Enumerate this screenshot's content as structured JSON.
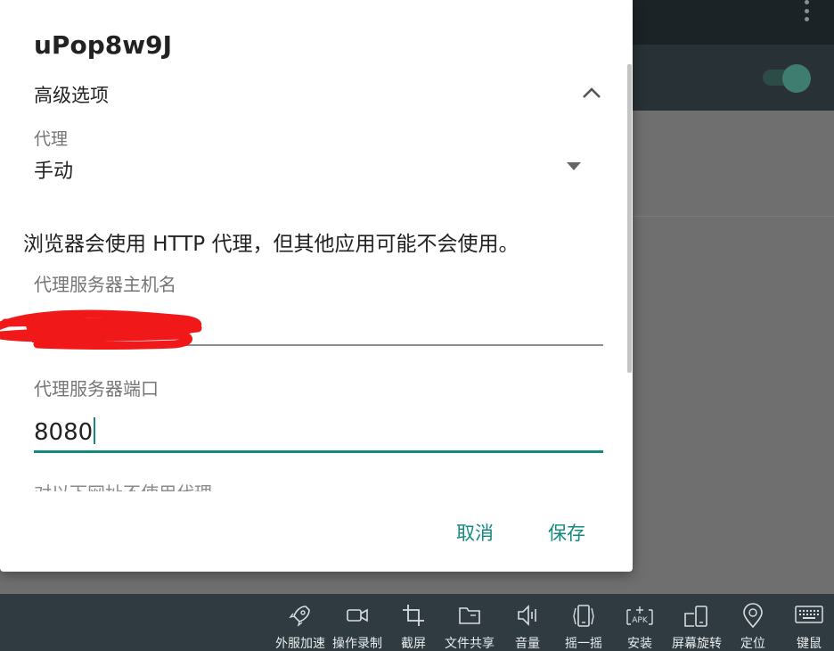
{
  "dialog": {
    "title": "uPop8w9J",
    "advanced_label": "高级选项",
    "proxy": {
      "label": "代理",
      "value": "手动"
    },
    "warning": "浏览器会使用 HTTP 代理，但其他应用可能不会使用。",
    "hostname": {
      "label": "代理服务器主机名",
      "value": ""
    },
    "port": {
      "label": "代理服务器端口",
      "value": "8080"
    },
    "bypass_label": "对以下网址不使用代理",
    "cancel_label": "取消",
    "save_label": "保存",
    "accent_color": "#138a7d"
  },
  "toolbar": {
    "items": [
      {
        "label": "外服加速",
        "icon": "rocket-icon"
      },
      {
        "label": "操作录制",
        "icon": "video-camera-icon"
      },
      {
        "label": "截屏",
        "icon": "crop-icon"
      },
      {
        "label": "文件共享",
        "icon": "folder-icon"
      },
      {
        "label": "音量",
        "icon": "speaker-icon"
      },
      {
        "label": "摇一摇",
        "icon": "shake-phone-icon"
      },
      {
        "label": "安装",
        "icon": "apk-install-icon"
      },
      {
        "label": "屏幕旋转",
        "icon": "screen-rotate-icon"
      },
      {
        "label": "定位",
        "icon": "location-pin-icon"
      },
      {
        "label": "键鼠",
        "icon": "keyboard-icon"
      }
    ]
  }
}
